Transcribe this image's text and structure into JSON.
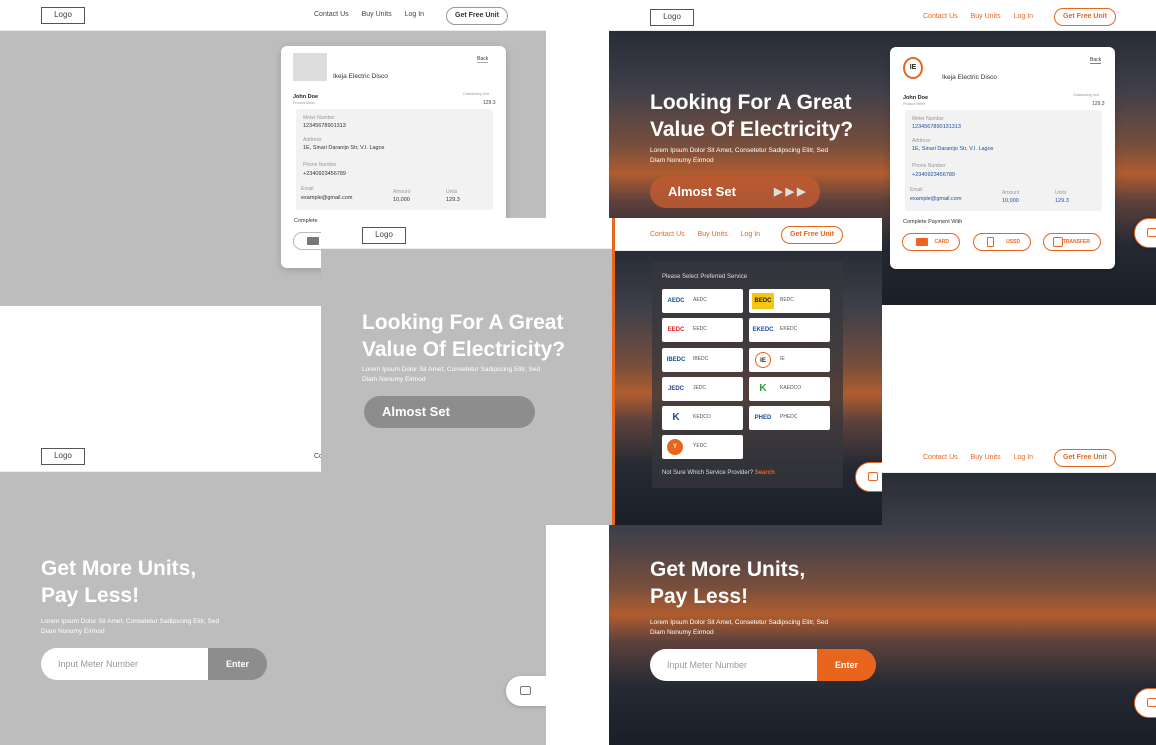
{
  "nav": {
    "logo": "Logo",
    "links": [
      "Contact Us",
      "Buy Units",
      "Log In"
    ],
    "cta": "Get Free Unit"
  },
  "hero_electricity": {
    "title_line1": "Looking For A Great",
    "title_line2": "Value Of Electricity?",
    "sub_line1": "Lorem Ipsum Dolor Sit Amet, Consetetur Sadipscing Elitr, Sed",
    "sub_line2": "Diam Nonumy Eirmod",
    "button": "Almost Set"
  },
  "hero_units": {
    "title_line1": "Get More Units,",
    "title_line2": "Pay Less!",
    "sub_line1": "Lorem Ipsum Dolor Sit Amet, Consetetur Sadipscing Elitr, Sed",
    "sub_line2": "Diam Nonumy Eirmod",
    "input_placeholder": "Input Meter Number",
    "enter": "Enter"
  },
  "summary_card": {
    "back": "Back",
    "disco": "Ikeja Electric Disco",
    "name": "John Doe",
    "name_caption": "Product Meter",
    "outstanding_caption": "Outstanding Unit",
    "outstanding_value": "129.3",
    "meter_label": "Meter Number",
    "meter_value": "12345678901313",
    "meter_value_alt": "1234567890131313",
    "address_label": "Address",
    "address_value": "1E, Sinari Daranijo Str, V.I. Lagos",
    "phone_label": "Phone Number",
    "phone_value": "+2340923456789",
    "email_label": "Email",
    "email_value": "example@gmail.com",
    "amount_label": "Amount",
    "amount_value": "10,000",
    "units_label": "Units",
    "units_value": "129.3",
    "payment_heading": "Complete Payment With",
    "payment_heading_short": "Complete",
    "pay_card": "CARD",
    "pay_ussd": "USSD",
    "pay_transfer": "TRANSFER"
  },
  "service_panel": {
    "title": "Please Select Preferred Service",
    "services": [
      "AEDC",
      "BEDC",
      "EEDC",
      "EKEDC",
      "IBEDC",
      "IE",
      "JEDC",
      "KAEDCO",
      "KEDCO",
      "PHEDC",
      "YEDC"
    ],
    "footer_text": "Not Sure Which Service Provider?",
    "footer_link": "Search"
  },
  "partial_text": {
    "co": "Co"
  },
  "colors": {
    "accent": "#e8651e",
    "grey_bg": "#bdbdbd",
    "grey_pill": "#8d8d8d"
  }
}
